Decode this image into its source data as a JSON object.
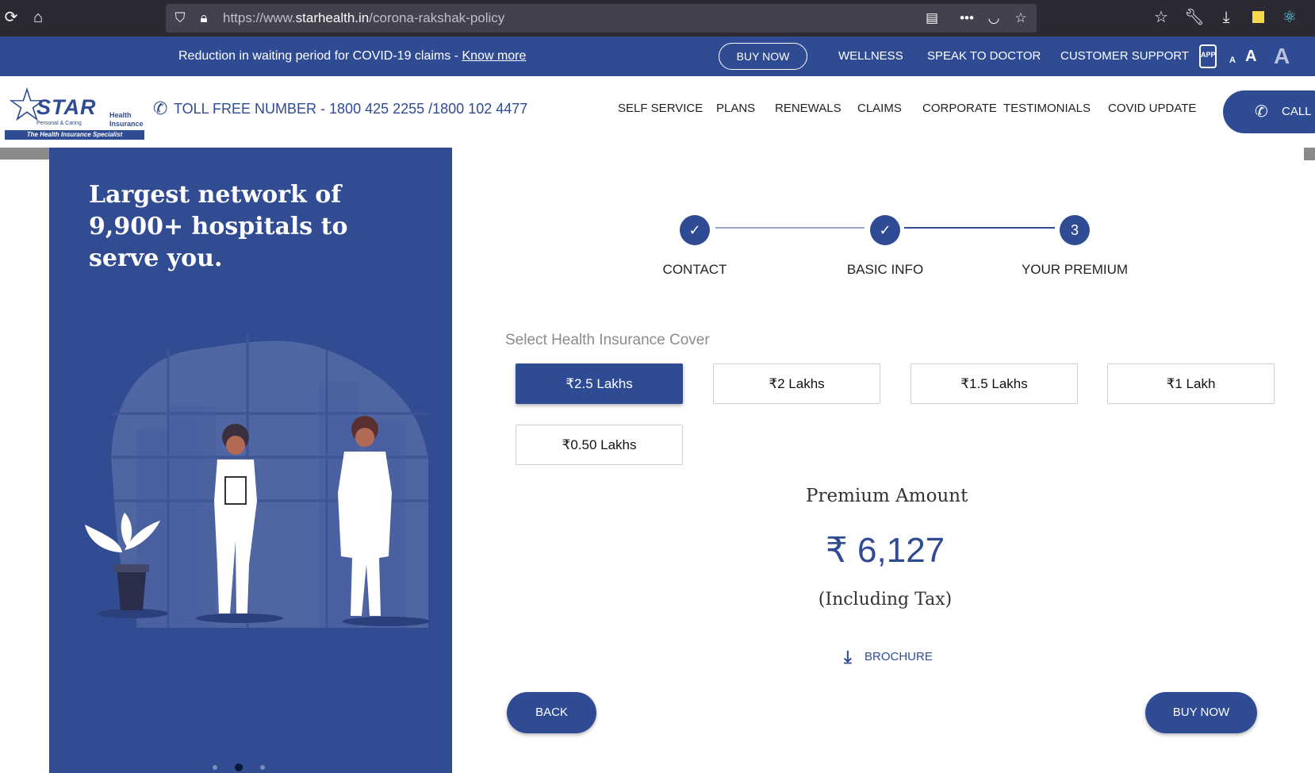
{
  "browser": {
    "url_prefix": "https://www.",
    "url_domain": "starhealth.in",
    "url_path": "/corona-rakshak-policy"
  },
  "topbar": {
    "announcement": "Reduction in waiting period for COVID-19 claims - ",
    "know_more": "Know more",
    "buy_now": "BUY NOW",
    "links": [
      "WELLNESS",
      "SPEAK TO DOCTOR",
      "CUSTOMER SUPPORT"
    ],
    "app_label": "APP",
    "font_small": "A",
    "font_medium": "A",
    "font_large": "A"
  },
  "header": {
    "logo": {
      "word": "STAR",
      "sub": "Personal & Caring",
      "health_line1": "Health",
      "health_line2": "Insurance",
      "tagline": "The Health Insurance Specialist"
    },
    "tollfree": "TOLL FREE NUMBER - 1800 425 2255 /1800 102 4477",
    "nav": [
      "SELF SERVICE",
      "PLANS",
      "RENEWALS",
      "CLAIMS",
      "CORPORATE",
      "TESTIMONIALS",
      "COVID UPDATE"
    ],
    "call_label": "CALL"
  },
  "left_panel": {
    "heading": "Largest network of 9,900+ hospitals to serve you.",
    "carousel_active_index": 1,
    "carousel_count": 3
  },
  "stepper": {
    "steps": [
      {
        "label": "CONTACT",
        "state": "done"
      },
      {
        "label": "BASIC INFO",
        "state": "done"
      },
      {
        "label": "YOUR PREMIUM",
        "state": "current",
        "number": "3"
      }
    ]
  },
  "cover": {
    "title": "Select Health Insurance Cover",
    "options": [
      "₹2.5 Lakhs",
      "₹2 Lakhs",
      "₹1.5 Lakhs",
      "₹1 Lakh",
      "₹0.50 Lakhs"
    ],
    "selected": "₹2.5 Lakhs"
  },
  "premium": {
    "label": "Premium Amount",
    "amount": "₹ 6,127",
    "tax_note": "(Including Tax)"
  },
  "actions": {
    "brochure": "BROCHURE",
    "back": "BACK",
    "buy_now": "BUY NOW"
  },
  "colors": {
    "brand_blue": "#2f4b94",
    "panel_blue": "#324c93"
  }
}
